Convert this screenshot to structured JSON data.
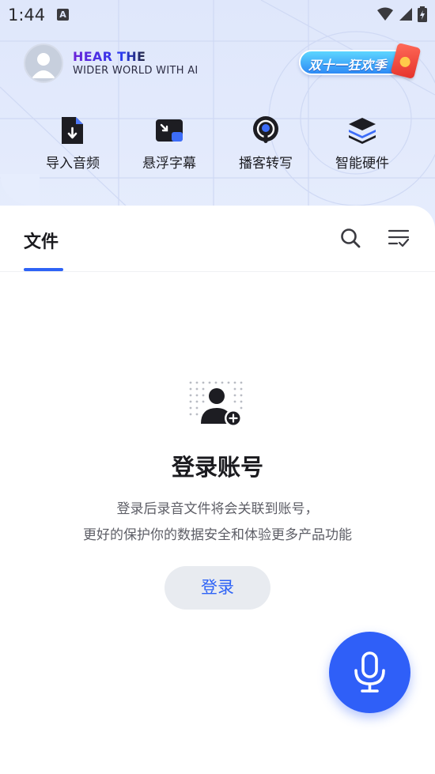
{
  "status_bar": {
    "time": "1:44",
    "notification_glyph": "A",
    "icons": [
      "wifi-icon",
      "signal-icon",
      "battery-icon"
    ]
  },
  "header": {
    "brand_line1": "HEAR THE",
    "brand_line2": "WIDER WORLD WITH AI",
    "promo_label": "双十一狂欢季"
  },
  "actions": [
    {
      "label": "导入音频",
      "icon": "import-audio-icon"
    },
    {
      "label": "悬浮字幕",
      "icon": "floating-subtitle-icon"
    },
    {
      "label": "播客转写",
      "icon": "podcast-transcribe-icon"
    },
    {
      "label": "智能硬件",
      "icon": "smart-hardware-icon"
    }
  ],
  "tabs": {
    "files_label": "文件"
  },
  "empty_state": {
    "title": "登录账号",
    "desc_line1": "登录后录音文件将会关联到账号，",
    "desc_line2": "更好的保护你的数据安全和体验更多产品功能",
    "login_label": "登录"
  },
  "colors": {
    "accent": "#2e63f6",
    "fab": "#2f5ff8",
    "header_bg": "#e3eafc"
  }
}
